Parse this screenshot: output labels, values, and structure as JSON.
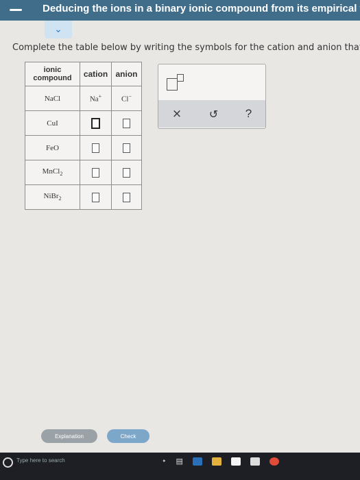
{
  "header": {
    "title": "Deducing the ions in a binary ionic compound from its empirical f..."
  },
  "instruction": "Complete the table below by writing the symbols for the cation and anion that m",
  "table": {
    "headers": [
      "ionic compound",
      "cation",
      "anion"
    ],
    "rows": [
      {
        "compound": "NaCl",
        "cation": "Na",
        "cation_charge": "+",
        "anion": "Cl",
        "anion_charge": "−"
      },
      {
        "compound": "CuI"
      },
      {
        "compound": "FeO"
      },
      {
        "compound": "MnCl",
        "subscript": "2"
      },
      {
        "compound": "NiBr",
        "subscript": "2"
      }
    ]
  },
  "toolbox": {
    "template_icon": "superscript-template-icon",
    "actions": [
      {
        "name": "clear",
        "label": "×"
      },
      {
        "name": "undo",
        "label": "↺"
      },
      {
        "name": "help",
        "label": "?"
      }
    ]
  },
  "buttons": {
    "explanation": "Explanation",
    "check": "Check"
  },
  "taskbar": {
    "search_placeholder": "Type here to search"
  }
}
